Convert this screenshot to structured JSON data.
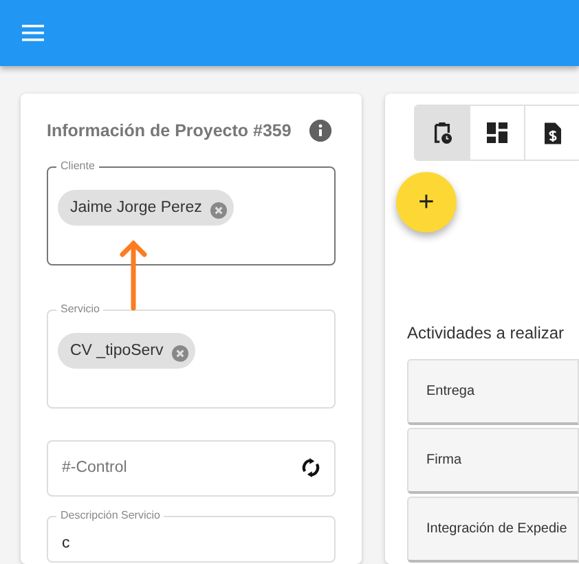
{
  "project_title": "Información de Proyecto #359",
  "fields": [
    {
      "kind": "chips",
      "label": "Cliente",
      "focused": true,
      "chips": [
        "Jaime Jorge Perez"
      ]
    },
    {
      "kind": "chips",
      "label": "Servicio",
      "focused": false,
      "chips": [
        "CV _tipoServ"
      ]
    },
    {
      "kind": "action",
      "placeholder": "#-Control"
    },
    {
      "kind": "text",
      "label": "Descripción Servicio",
      "value": "c"
    }
  ],
  "tabs": [
    {
      "selected": true
    },
    {
      "selected": false
    },
    {
      "selected": false
    }
  ],
  "fab": {
    "label": "+"
  },
  "activities_heading": "Actividades a realizar",
  "activities": [
    "Entrega",
    "Firma",
    "Integración de Expedie"
  ]
}
